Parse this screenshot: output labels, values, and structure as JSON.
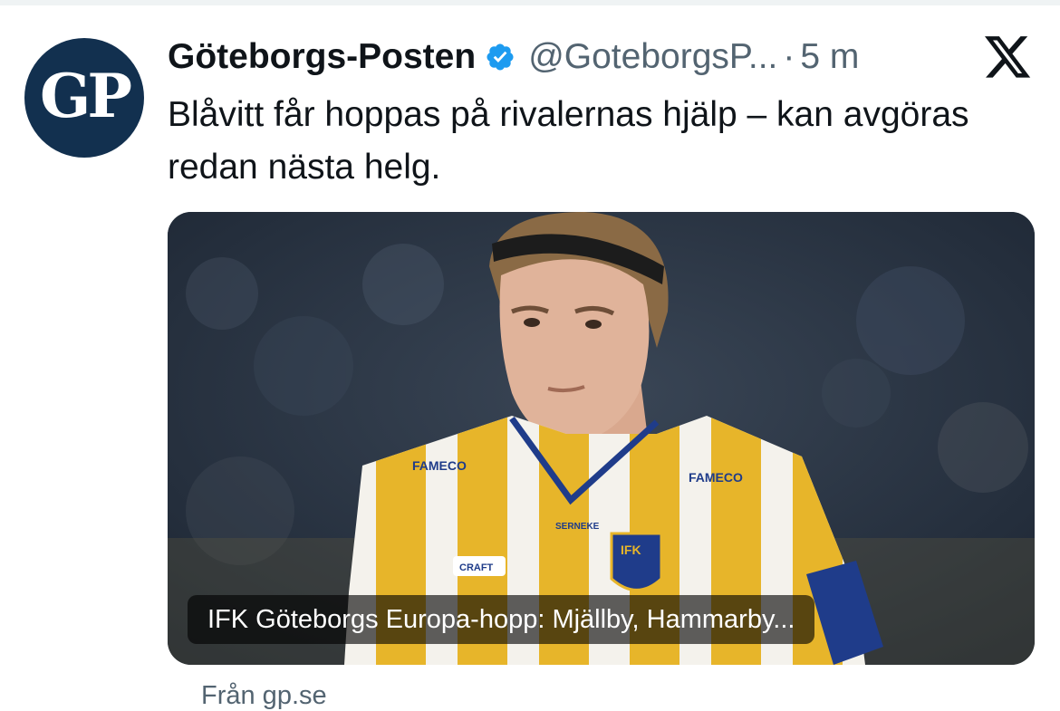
{
  "tweet": {
    "avatar_text": "GP",
    "display_name": "Göteborgs-Posten",
    "handle": "@GoteborgsP...",
    "separator": "·",
    "time": "5 m",
    "verified_icon": "verified-badge-icon",
    "platform_icon": "x-logo-icon",
    "text": "Blåvitt får hoppas på rivalernas hjälp – kan avgöras redan nästa helg.",
    "card": {
      "image_description": "football player in striped IFK Göteborg shirt",
      "shirt_sponsor": "FAMECO",
      "shirt_brand_neck": "SERNEKE",
      "shirt_kit_brand": "CRAFT",
      "crest_text": "IFK",
      "caption": "IFK Göteborgs Europa-hopp: Mjällby, Hammarby...",
      "source": "Från gp.se"
    },
    "colors": {
      "avatar_bg": "#12304f",
      "verified": "#1d9bf0",
      "secondary_text": "#536471",
      "shirt_yellow": "#e7b52a",
      "shirt_blue": "#1f3c8a"
    }
  }
}
